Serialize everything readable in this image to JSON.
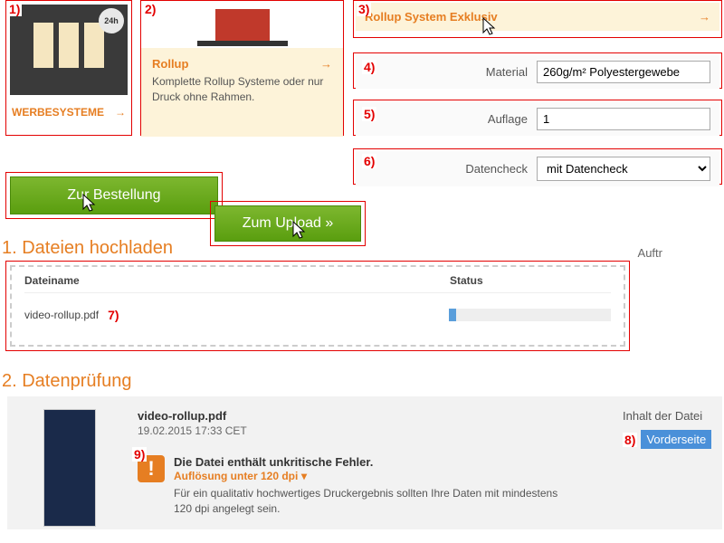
{
  "markers": {
    "m1": "1)",
    "m2": "2)",
    "m3": "3)",
    "m4": "4)",
    "m5": "5)",
    "m6": "6)",
    "m7": "7)",
    "m8": "8)",
    "m9": "9)"
  },
  "tile1": {
    "badge": "24h",
    "label": "WERBESYSTEME",
    "arrow": "→"
  },
  "tile2": {
    "title": "Rollup",
    "arrow": "→",
    "desc": "Komplette Rollup Systeme oder nur Druck ohne Rahmen."
  },
  "tile3": {
    "title": "Rollup System Exklusiv",
    "arrow": "→"
  },
  "row4": {
    "label": "Material",
    "value": "260g/m² Polyestergewebe"
  },
  "row5": {
    "label": "Auflage",
    "value": "1"
  },
  "row6": {
    "label": "Datencheck",
    "value": "mit Datencheck"
  },
  "buttons": {
    "order": "Zur Bestellung",
    "upload": "Zum Upload »"
  },
  "section1": "1. Dateien hochladen",
  "upload": {
    "col1": "Dateiname",
    "col2": "Status",
    "file": "video-rollup.pdf",
    "auftr": "Auftr"
  },
  "section2": "2. Datenprüfung",
  "check": {
    "file": "video-rollup.pdf",
    "date": "19.02.2015 17:33 CET",
    "warn_title": "Die Datei enthält unkritische Fehler.",
    "warn_link": "Auflösung unter 120 dpi",
    "warn_caret": "▾",
    "warn_desc": "Für ein qualitativ hochwertiges Druckergebnis sollten Ihre Daten mit mindestens 120 dpi angelegt sein.",
    "right_label": "Inhalt der Datei",
    "right_sel": "Vorderseite",
    "excl": "!"
  }
}
